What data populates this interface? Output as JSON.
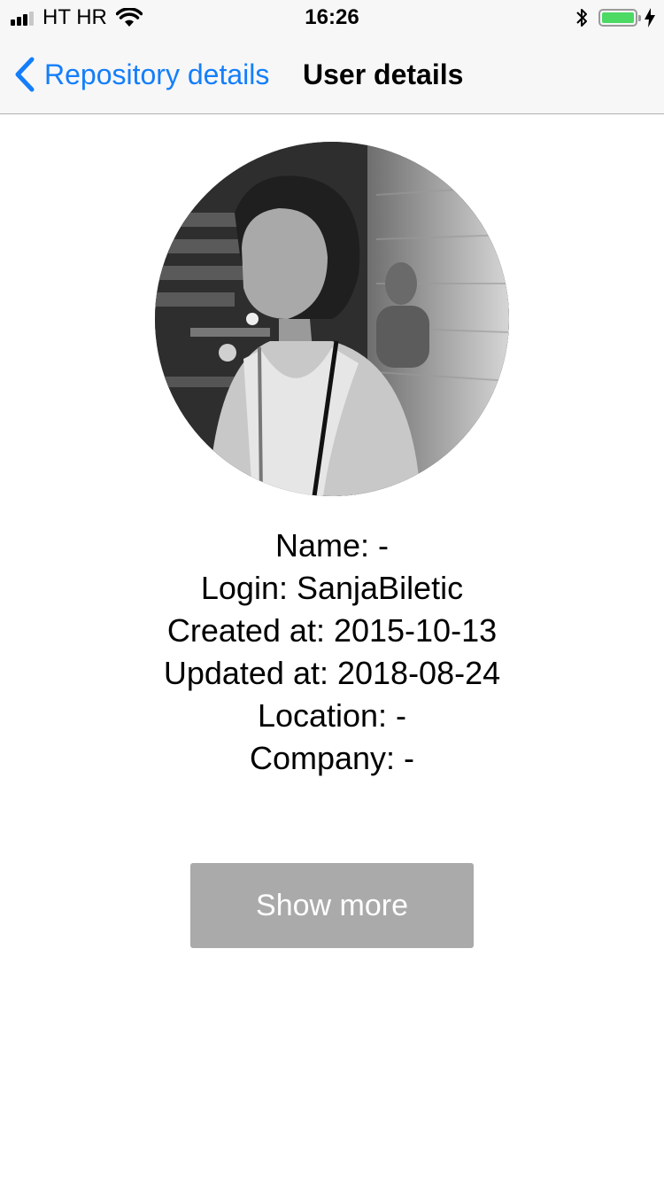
{
  "status_bar": {
    "carrier": "HT HR",
    "time": "16:26",
    "signal_icon": "signal-bars-icon",
    "wifi_icon": "wifi-icon",
    "bluetooth_icon": "bluetooth-icon",
    "battery_icon": "battery-icon",
    "charging_icon": "charging-bolt-icon",
    "battery_level_fraction": 1.0,
    "battery_color": "#4cd964"
  },
  "nav": {
    "back_label": "Repository details",
    "back_icon": "chevron-left-icon",
    "title": "User details",
    "accent_color": "#147efb"
  },
  "user": {
    "name_line": "Name: -",
    "login_line": "Login: SanjaBiletic",
    "created_line": "Created at: 2015-10-13",
    "updated_line": "Updated at: 2018-08-24",
    "location_line": "Location: -",
    "company_line": "Company: -"
  },
  "actions": {
    "show_more_label": "Show more",
    "show_more_color": "#aaaaaa"
  }
}
